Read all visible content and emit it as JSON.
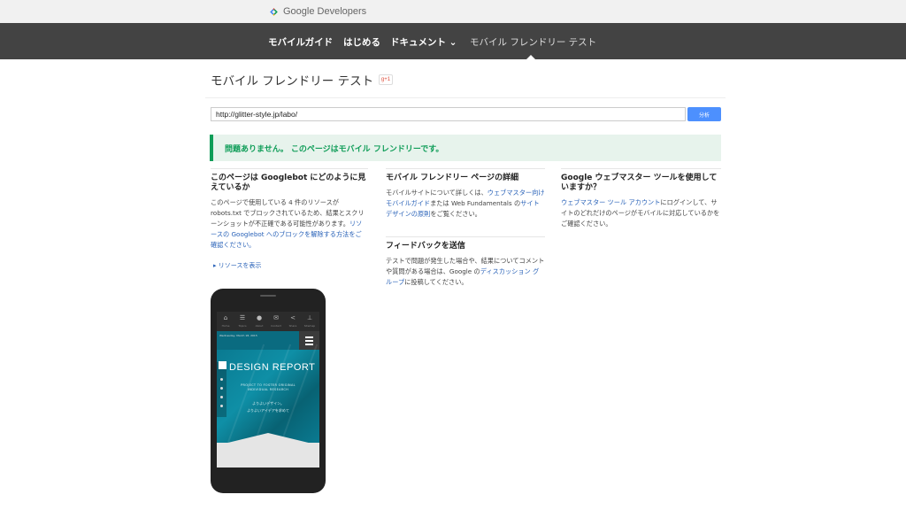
{
  "header": {
    "brand": "Google Developers",
    "nav": [
      "モバイルガイド",
      "はじめる",
      "ドキュメント ⌄",
      "モバイル フレンドリー テスト"
    ]
  },
  "page": {
    "title": "モバイル フレンドリー テスト",
    "gplus": "g+1",
    "url_value": "http://glitter-style.jp/labo/",
    "analyze_label": "分析",
    "result": "問題ありません。 このページはモバイル フレンドリーです。"
  },
  "col1": {
    "heading": "このページは Googlebot にどのように見えているか",
    "body_pre": "このページで使用している 4 件のリソースが robots.txt でブロックされているため、結果とスクリーンショットが不正確である可能性があります。",
    "body_link": "リソースの Googlebot へのブロックを解除する方法をご確認ください。",
    "show_link": "▸ リソースを表示"
  },
  "col2": {
    "heading": "モバイル フレンドリー ページの詳細",
    "body_pre": "モバイルサイトについて詳しくは、",
    "link1": "ウェブマスター向けモバイルガイド",
    "body_mid": "または Web Fundamentals の",
    "link2": "サイト デザインの原則",
    "body_post": "をご覧ください。",
    "heading2": "フィードバックを送信",
    "body2_pre": "テストで問題が発生した場合や、結果についてコメントや質問がある場合は、Google の",
    "link3": "ディスカッション グループ",
    "body2_post": "に投稿してください。"
  },
  "col3": {
    "heading": "Google ウェブマスター ツールを使用していますか？",
    "link": "ウェブマスター ツール アカウント",
    "body_post": "にログインして、サイトのどれだけのページがモバイルに対応しているかをご確認ください。"
  },
  "phone": {
    "tabs": [
      "Home",
      "Topics",
      "About",
      "Contact",
      "Share",
      "Sitemap"
    ],
    "date": "Wednesday, March 18, 2015",
    "title": "DESIGN REPORT",
    "sub1": "PROJECT TO FOSTER ORIGINAL",
    "sub2": "INDIVIDUAL RESEARCH",
    "jp1": "よりよいデザイン。",
    "jp2": "よりよいアイデアを求めて"
  },
  "colors": {
    "nav_bg": "#434343",
    "success": "#0f9d58",
    "success_bg": "#e7f3ec",
    "link": "#2962b8",
    "button": "#4d90fe"
  }
}
